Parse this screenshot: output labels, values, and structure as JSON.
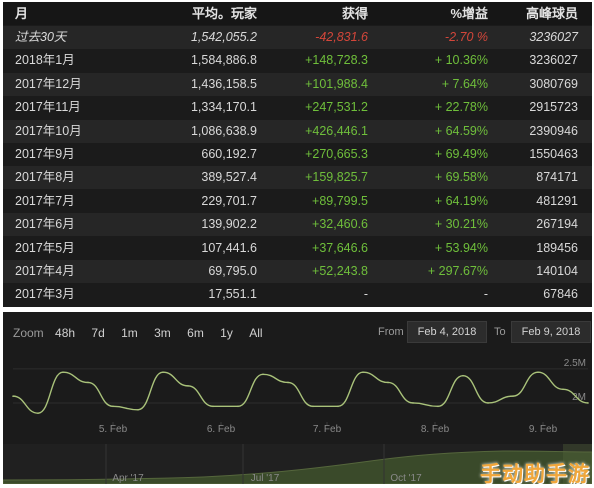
{
  "table": {
    "headers": {
      "month": "月",
      "avg": "平均。玩家",
      "gain": "获得",
      "pct": "%增益",
      "peak": "高峰球员"
    },
    "rows": [
      {
        "month": "过去30天",
        "avg": "1,542,055.2",
        "gain": "-42,831.6",
        "pct": "-2.70 %",
        "peak": "3236027",
        "sign": "neg",
        "italic": true
      },
      {
        "month": "2018年1月",
        "avg": "1,584,886.8",
        "gain": "+148,728.3",
        "pct": "+ 10.36%",
        "peak": "3236027",
        "sign": "pos"
      },
      {
        "month": "2017年12月",
        "avg": "1,436,158.5",
        "gain": "+101,988.4",
        "pct": "+ 7.64%",
        "peak": "3080769",
        "sign": "pos"
      },
      {
        "month": "2017年11月",
        "avg": "1,334,170.1",
        "gain": "+247,531.2",
        "pct": "+ 22.78%",
        "peak": "2915723",
        "sign": "pos"
      },
      {
        "month": "2017年10月",
        "avg": "1,086,638.9",
        "gain": "+426,446.1",
        "pct": "+ 64.59%",
        "peak": "2390946",
        "sign": "pos"
      },
      {
        "month": "2017年9月",
        "avg": "660,192.7",
        "gain": "+270,665.3",
        "pct": "+ 69.49%",
        "peak": "1550463",
        "sign": "pos"
      },
      {
        "month": "2017年8月",
        "avg": "389,527.4",
        "gain": "+159,825.7",
        "pct": "+ 69.58%",
        "peak": "874171",
        "sign": "pos"
      },
      {
        "month": "2017年7月",
        "avg": "229,701.7",
        "gain": "+89,799.5",
        "pct": "+ 64.19%",
        "peak": "481291",
        "sign": "pos"
      },
      {
        "month": "2017年6月",
        "avg": "139,902.2",
        "gain": "+32,460.6",
        "pct": "+ 30.21%",
        "peak": "267194",
        "sign": "pos"
      },
      {
        "month": "2017年5月",
        "avg": "107,441.6",
        "gain": "+37,646.6",
        "pct": "+ 53.94%",
        "peak": "189456",
        "sign": "pos"
      },
      {
        "month": "2017年4月",
        "avg": "69,795.0",
        "gain": "+52,243.8",
        "pct": "+ 297.67%",
        "peak": "140104",
        "sign": "pos"
      },
      {
        "month": "2017年3月",
        "avg": "17,551.1",
        "gain": "-",
        "pct": "-",
        "peak": "67846",
        "sign": "none"
      }
    ]
  },
  "graph": {
    "zoom_label": "Zoom",
    "zoom_options": [
      "48h",
      "7d",
      "1m",
      "3m",
      "6m",
      "1y",
      "All"
    ],
    "from_label": "From",
    "from_date": "Feb 4, 2018",
    "to_label": "To",
    "to_date": "Feb 9, 2018",
    "y_tick_labels": [
      "2.5M",
      "2M"
    ],
    "x_tick_labels": [
      "5. Feb",
      "6. Feb",
      "7. Feb",
      "8. Feb",
      "9. Feb"
    ],
    "navigator_labels": [
      "Apr '17",
      "Jul '17",
      "Oct '17"
    ],
    "colors": {
      "line": "#a9c27a",
      "navigator_fill": "#3a4a2a",
      "panel": "#1b1b1b"
    }
  },
  "chart_data": {
    "type": "line",
    "title": "",
    "xlabel": "",
    "ylabel": "",
    "x": [
      "Feb 4 00:00",
      "Feb 4 06:00",
      "Feb 4 12:00",
      "Feb 4 18:00",
      "Feb 5 00:00",
      "Feb 5 06:00",
      "Feb 5 12:00",
      "Feb 5 18:00",
      "Feb 6 00:00",
      "Feb 6 06:00",
      "Feb 6 12:00",
      "Feb 6 18:00",
      "Feb 7 00:00",
      "Feb 7 06:00",
      "Feb 7 12:00",
      "Feb 7 18:00",
      "Feb 8 00:00",
      "Feb 8 06:00",
      "Feb 8 12:00",
      "Feb 8 18:00",
      "Feb 9 00:00",
      "Feb 9 06:00",
      "Feb 9 12:00",
      "Feb 9 18:00"
    ],
    "series": [
      {
        "values": [
          2.1,
          1.85,
          2.45,
          2.3,
          1.95,
          1.9,
          2.45,
          2.25,
          1.95,
          1.95,
          2.42,
          2.3,
          1.95,
          1.95,
          2.45,
          2.3,
          2.0,
          1.95,
          2.4,
          2.0,
          2.1,
          2.45,
          2.2,
          2.0
        ]
      }
    ],
    "ylim": [
      1.75,
      2.6
    ],
    "y_unit": "M",
    "grid": true
  },
  "watermark": "手动助手游"
}
